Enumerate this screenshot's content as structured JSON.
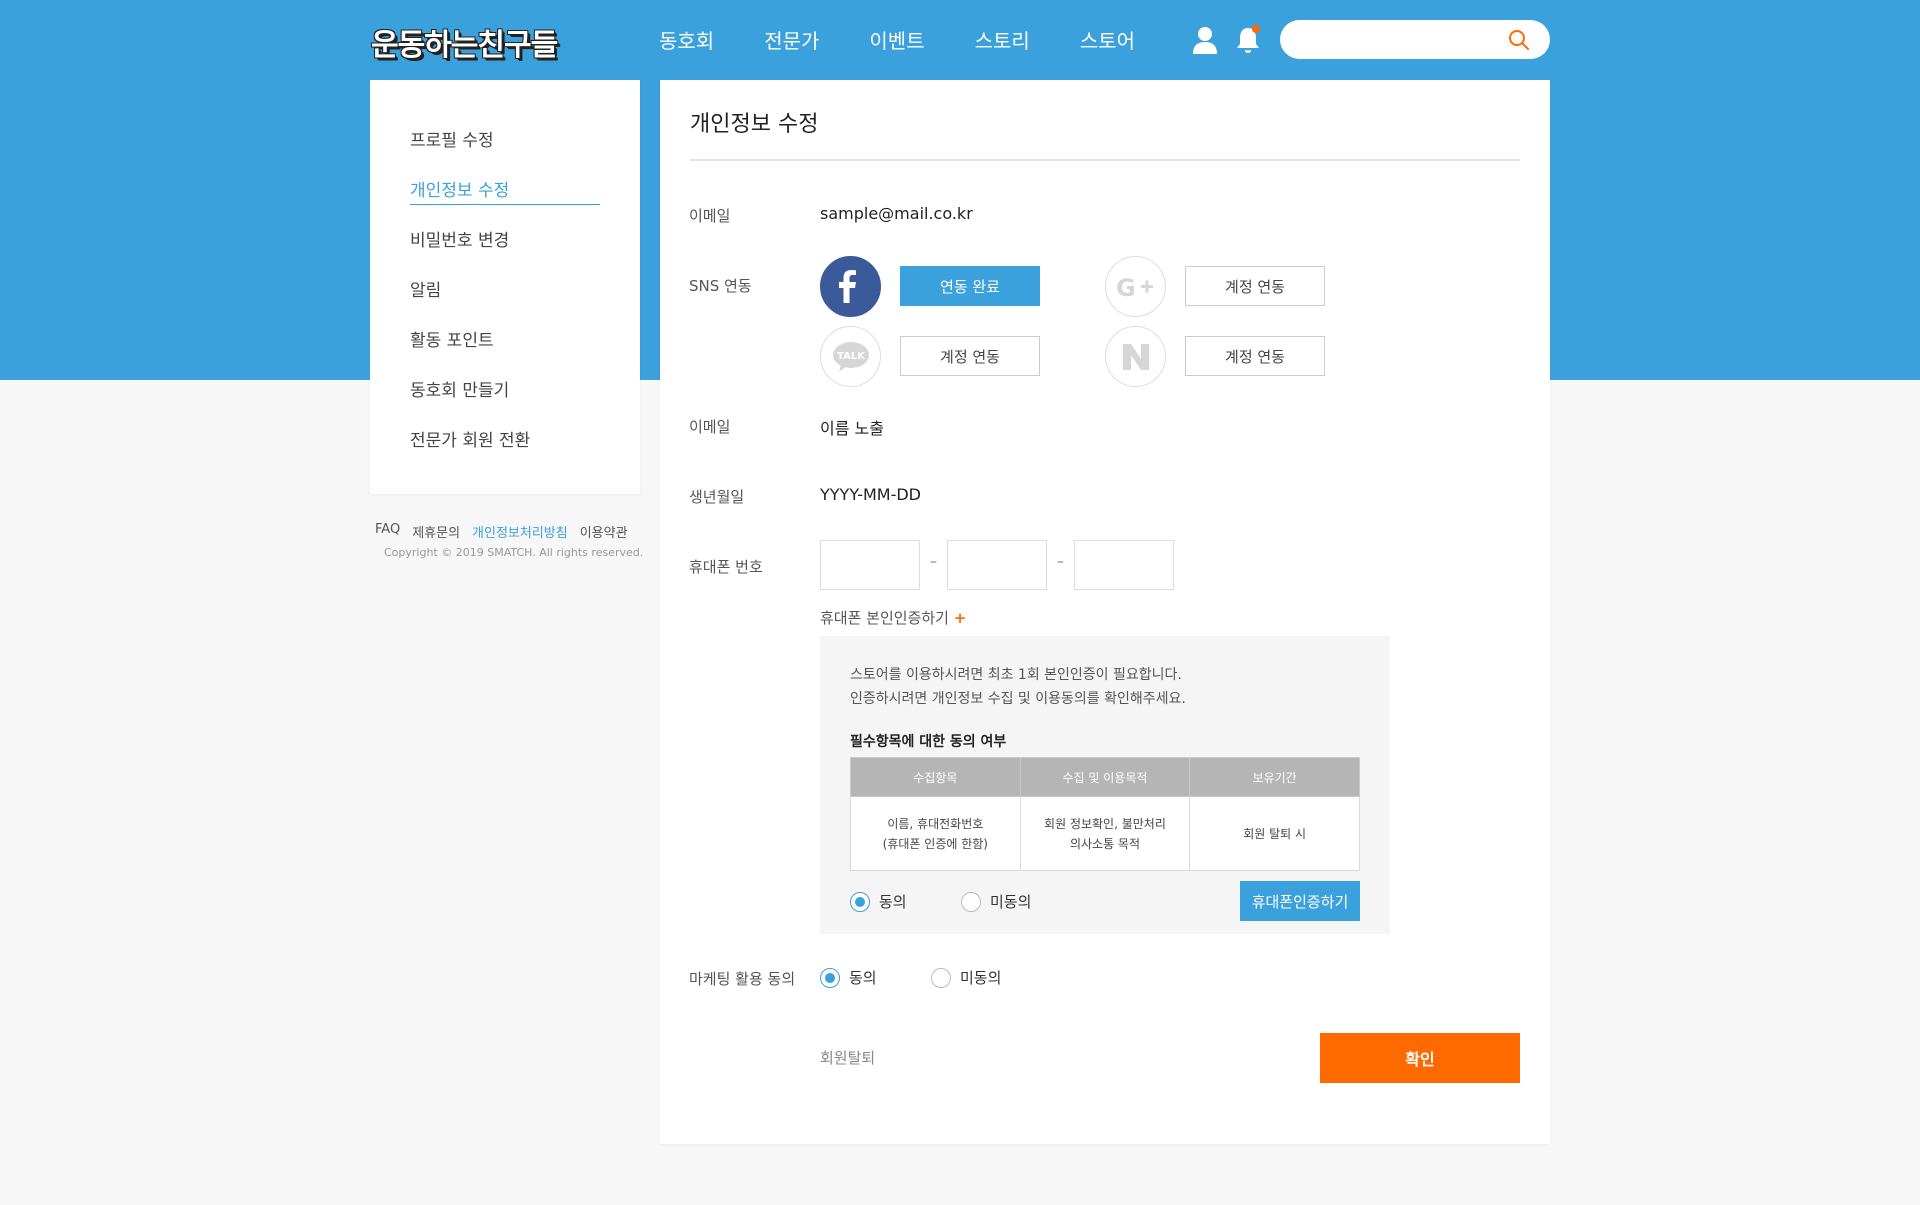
{
  "header": {
    "logo": "운동하는친구들",
    "nav": [
      "동호회",
      "전문가",
      "이벤트",
      "스토리",
      "스토어"
    ],
    "search_placeholder": ""
  },
  "sidebar": {
    "items": [
      {
        "label": "프로필 수정",
        "active": false
      },
      {
        "label": "개인정보 수정",
        "active": true
      },
      {
        "label": "비밀번호 변경",
        "active": false
      },
      {
        "label": "알림",
        "active": false
      },
      {
        "label": "활동 포인트",
        "active": false
      },
      {
        "label": "동호회 만들기",
        "active": false
      },
      {
        "label": "전문가 회원 전환",
        "active": false
      }
    ],
    "footer_links": [
      "FAQ",
      "제휴문의",
      "개인정보처리방침",
      "이용약관"
    ],
    "copyright": "Copyright © 2019 SMATCH. All rights reserved."
  },
  "main": {
    "title": "개인정보 수정",
    "email_label": "이메일",
    "email_value": "sample@mail.co.kr",
    "sns_label": "SNS 연동",
    "sns": {
      "facebook_btn": "연동 완료",
      "google_btn": "계정 연동",
      "kakao_btn": "계정 연동",
      "naver_btn": "계정 연동",
      "kakao_icon_text": "TALK"
    },
    "name_label": "이메일",
    "name_value": "이름 노출",
    "birth_label": "생년월일",
    "birth_value": "YYYY-MM-DD",
    "phone_label": "휴대폰 번호",
    "phone_dash": "–",
    "verify_link": "휴대폰 본인인증하기",
    "verify_plus": "+",
    "consent": {
      "line1": "스토어를 이용하시려면 최초 1회 본인인증이 필요합니다.",
      "line2": "인증하시려면 개인정보 수집 및 이용동의를 확인해주세요.",
      "subtitle": "필수항목에 대한 동의 여부",
      "headers": [
        "수집항목",
        "수집 및 이용목적",
        "보유기간"
      ],
      "cell1_line1": "이름, 휴대전화번호",
      "cell1_line2": "(휴대폰 인증에 한함)",
      "cell2_line1": "회원 정보확인, 불만처리",
      "cell2_line2": "의사소통 목적",
      "cell3": "회원 탈퇴 시",
      "agree": "동의",
      "disagree": "미동의",
      "verify_btn": "휴대폰인증하기"
    },
    "marketing_label": "마케팅 활용 동의",
    "marketing_agree": "동의",
    "marketing_disagree": "미동의",
    "withdraw": "회원탈퇴",
    "confirm": "확인"
  },
  "colors": {
    "primary_blue": "#3ba1dc",
    "accent_orange": "#ff6a00",
    "facebook": "#3b5a9a"
  }
}
